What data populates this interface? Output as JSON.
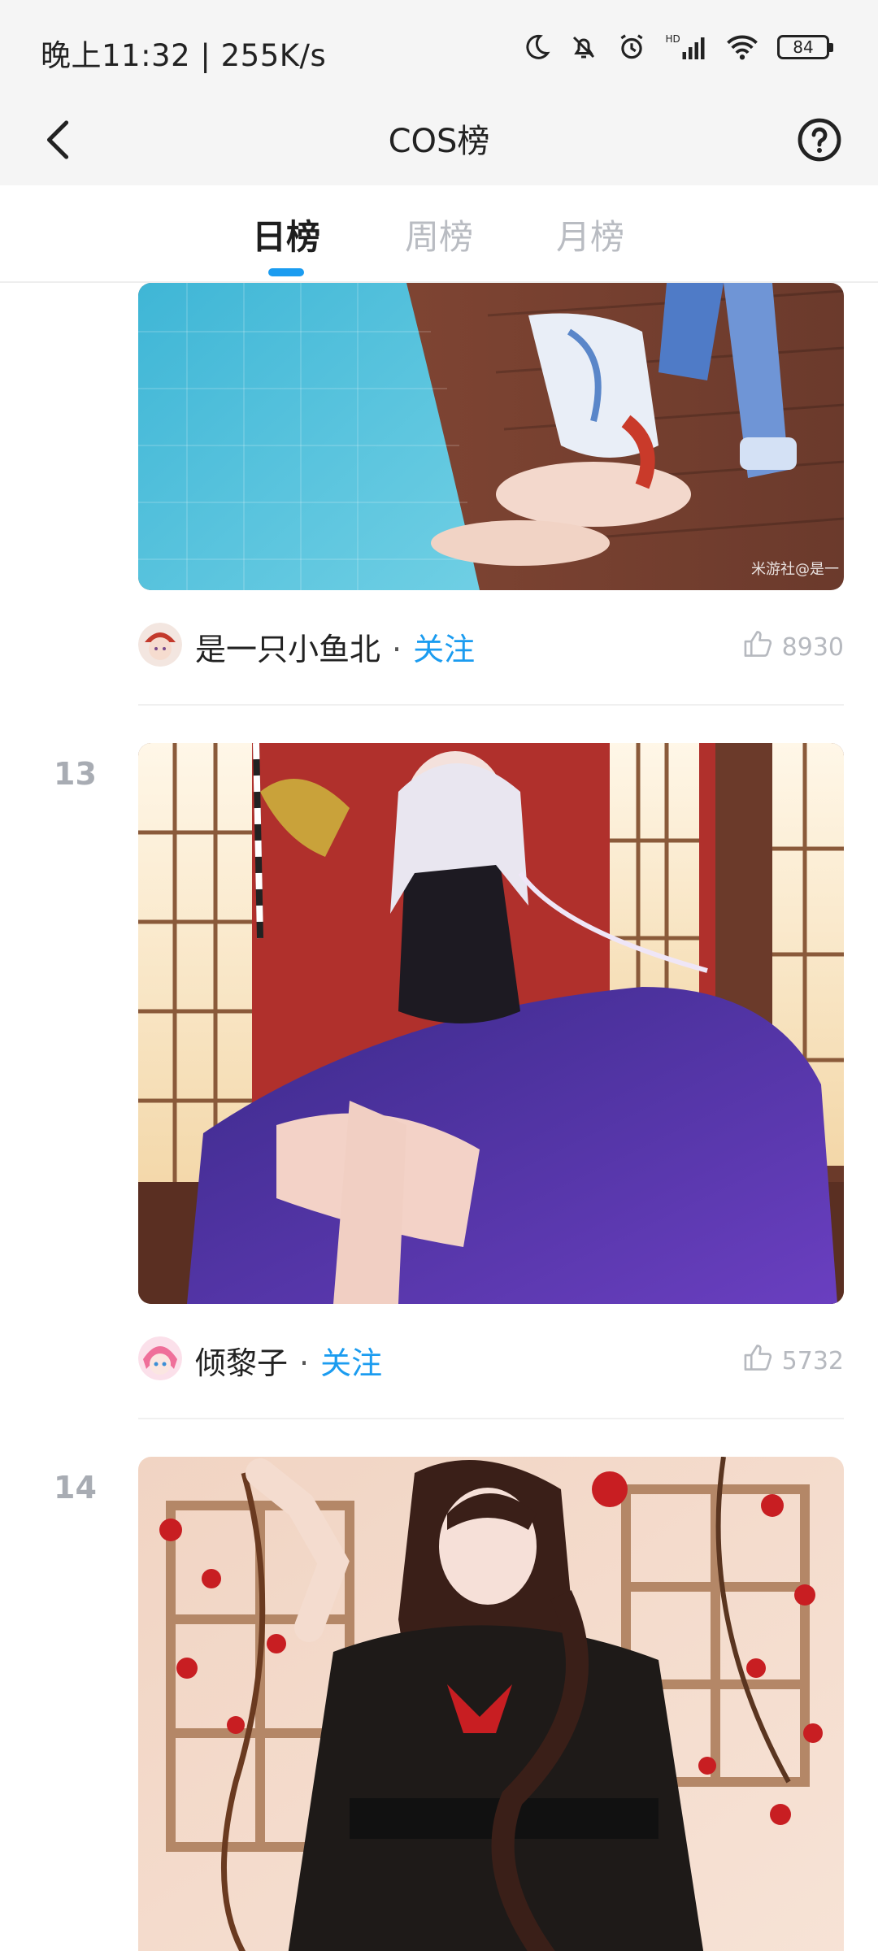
{
  "status_bar": {
    "time_speed": "晚上11:32 | 255K/s",
    "battery": "84",
    "icons": [
      "moon-icon",
      "bell-off-icon",
      "alarm-icon",
      "hd-signal-icon",
      "wifi-icon",
      "battery-icon"
    ]
  },
  "header": {
    "title": "COS榜",
    "back_icon": "chevron-left-icon",
    "help_icon": "question-circle-icon"
  },
  "tabs": [
    {
      "label": "日榜",
      "active": true
    },
    {
      "label": "周榜",
      "active": false
    },
    {
      "label": "月榜",
      "active": false
    }
  ],
  "posts": [
    {
      "rank": "",
      "author": "是一只小鱼北",
      "separator": "·",
      "follow": "关注",
      "likes": "8930",
      "watermark": "米游社@是一"
    },
    {
      "rank": "13",
      "author": "倾黎子",
      "separator": "·",
      "follow": "关注",
      "likes": "5732"
    },
    {
      "rank": "14"
    }
  ],
  "colors": {
    "accent": "#1b9cf0",
    "header_bg": "#f5f5f5",
    "muted": "#b6b9bf"
  }
}
